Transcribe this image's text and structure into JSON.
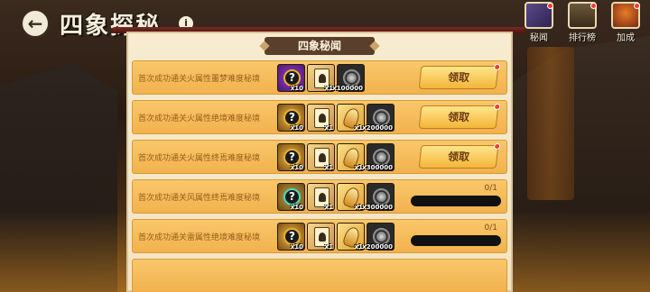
{
  "header": {
    "title": "四象探秘",
    "info_glyph": "i"
  },
  "top_icons": [
    {
      "label": "秘闻",
      "icon": "book-icon",
      "badge": true
    },
    {
      "label": "排行榜",
      "icon": "trophy-icon",
      "badge": true
    },
    {
      "label": "加成",
      "icon": "boost-icon",
      "badge": true
    }
  ],
  "panel": {
    "title": "四象秘闻",
    "rows": [
      {
        "desc": "首次成功通关火属性噩梦难度秘境",
        "rewards": [
          {
            "type": "orb-purple",
            "glyph": "?",
            "qty": "x10"
          },
          {
            "type": "card",
            "qty": "x1"
          },
          {
            "type": "coin",
            "qty": "x100000"
          }
        ],
        "state": "claim",
        "claim_label": "领取",
        "progress": null
      },
      {
        "desc": "首次成功通关火属性绝境难度秘境",
        "rewards": [
          {
            "type": "orb-gold",
            "glyph": "?",
            "qty": "x10"
          },
          {
            "type": "card",
            "qty": "x1"
          },
          {
            "type": "bell",
            "qty": "x1"
          },
          {
            "type": "coin",
            "qty": "x200000"
          }
        ],
        "state": "claim",
        "claim_label": "领取",
        "progress": null
      },
      {
        "desc": "首次成功通关火属性终焉难度秘境",
        "rewards": [
          {
            "type": "orb-gold",
            "glyph": "?",
            "qty": "x10"
          },
          {
            "type": "card",
            "qty": "x1"
          },
          {
            "type": "bell",
            "qty": "x1"
          },
          {
            "type": "coin",
            "qty": "x300000"
          }
        ],
        "state": "claim",
        "claim_label": "领取",
        "progress": null
      },
      {
        "desc": "首次成功通关风属性终焉难度秘境",
        "rewards": [
          {
            "type": "orb-teal",
            "glyph": "?",
            "qty": "x10"
          },
          {
            "type": "card",
            "qty": "x1"
          },
          {
            "type": "bell",
            "qty": "x1"
          },
          {
            "type": "coin",
            "qty": "x300000"
          }
        ],
        "state": "progress",
        "claim_label": "",
        "progress": {
          "text": "0/1",
          "fraction": 0
        }
      },
      {
        "desc": "首次成功通关雷属性绝境难度秘境",
        "rewards": [
          {
            "type": "orb-gold",
            "glyph": "?",
            "qty": "x10"
          },
          {
            "type": "card",
            "qty": "x1"
          },
          {
            "type": "bell",
            "qty": "x1"
          },
          {
            "type": "coin",
            "qty": "x200000"
          }
        ],
        "state": "progress",
        "claim_label": "",
        "progress": {
          "text": "0/1",
          "fraction": 0
        }
      }
    ]
  },
  "colors": {
    "row_bg": "#f1b24d",
    "claim_button": "#f3b53a",
    "progress_track": "#111111",
    "badge_red": "#ff3b2a"
  }
}
